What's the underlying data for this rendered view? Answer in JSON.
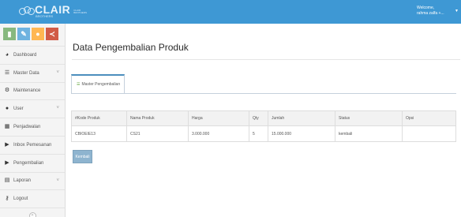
{
  "header": {
    "logo_text": "CLAIR",
    "logo_sub": "BROTHERS",
    "logo_tag": "CLAIR BROTHERS",
    "welcome_line1": "Welcome,",
    "welcome_line2": "rahma zalfa +...",
    "caret_icon": "caret-down-icon"
  },
  "sidebar": {
    "shortcuts": [
      {
        "icon": "chart-icon",
        "color": "#87b87f"
      },
      {
        "icon": "pencil-icon",
        "color": "#6fb3e0"
      },
      {
        "icon": "users-icon",
        "color": "#ffb752"
      },
      {
        "icon": "share-icon",
        "color": "#d15b47"
      }
    ],
    "items": [
      {
        "label": "Dashboard",
        "icon": "dashboard-icon",
        "has_submenu": false
      },
      {
        "label": "Master Data",
        "icon": "list-icon",
        "has_submenu": true
      },
      {
        "label": "Maintenance",
        "icon": "cogs-icon",
        "has_submenu": false
      },
      {
        "label": "User",
        "icon": "users-icon",
        "has_submenu": true
      },
      {
        "label": "Penjadwalan",
        "icon": "calendar-icon",
        "has_submenu": false
      },
      {
        "label": "Inbox Pemesanan",
        "icon": "truck-icon",
        "has_submenu": false
      },
      {
        "label": "Pengembalian",
        "icon": "truck-icon",
        "has_submenu": false
      },
      {
        "label": "Laporan",
        "icon": "table-icon",
        "has_submenu": true
      },
      {
        "label": "Logout",
        "icon": "key-icon",
        "has_submenu": false
      }
    ],
    "collapse_icon": "double-chevron-left-icon"
  },
  "main": {
    "title": "Data Pengembalian Produk",
    "tab_label": "Master Pengembalian",
    "tab_icon": "list-icon",
    "table": {
      "headers": [
        "#Kode Produk",
        "Nama Produk",
        "Harga",
        "Qty",
        "Jumlah",
        "Status",
        "Opsi"
      ],
      "rows": [
        [
          "CBIOEIE13",
          "CS21",
          "3.000.000",
          "5",
          "15.000.000",
          "kembali",
          ""
        ]
      ]
    },
    "back_button": "Kembali"
  },
  "colors": {
    "topbar": "#3e98d4",
    "tab_accent": "#4c8fbd",
    "button": "#8eb4cf"
  }
}
